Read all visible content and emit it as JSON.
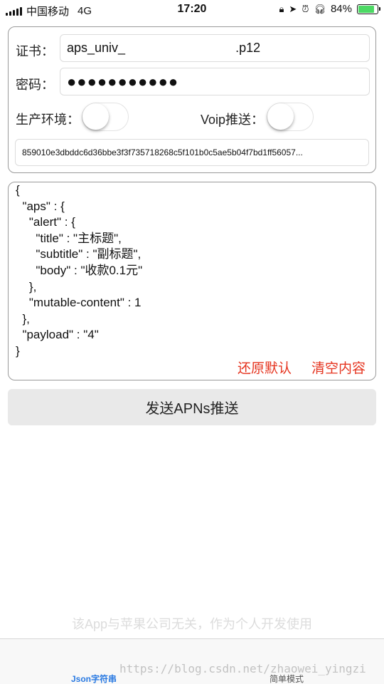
{
  "status_bar": {
    "carrier": "中国移动",
    "network": "4G",
    "time": "17:20",
    "battery_percent": "84%",
    "battery_level": 0.84,
    "icons": [
      "signal-icon",
      "orientation-lock-icon",
      "location-icon",
      "alarm-icon",
      "headphones-icon",
      "battery-icon"
    ]
  },
  "config": {
    "cert_label": "证书：",
    "cert_value": "aps_univ_                               .p12",
    "password_label": "密码：",
    "password_value": "●●●●●●●●●●●",
    "production_label": "生产环境：",
    "production_on": false,
    "voip_label": "Voip推送：",
    "voip_on": false,
    "device_token": "859010e3dbddc6d36bbe3f3f735718268c5f101b0c5ae5b04f7bd1ff56057..."
  },
  "payload": {
    "json_text": "{\n  \"aps\" : {\n    \"alert\" : {\n      \"title\" : \"主标题\",\n      \"subtitle\" : \"副标题\",\n      \"body\" : \"收款0.1元\"\n    },\n    \"mutable-content\" : 1\n  },\n  \"payload\" : \"4\"\n}",
    "restore_default_label": "还原默认",
    "clear_label": "清空内容",
    "action_color": "#e5331e"
  },
  "send_button_label": "发送APNs推送",
  "disclaimer": "该App与苹果公司无关，作为个人开发使用",
  "tabs": [
    {
      "label": "Json字符串",
      "active": true,
      "color": "#2a7ae2"
    },
    {
      "label": "简单模式",
      "active": false
    }
  ],
  "watermark": "https://blog.csdn.net/zhaowei_yingzi"
}
